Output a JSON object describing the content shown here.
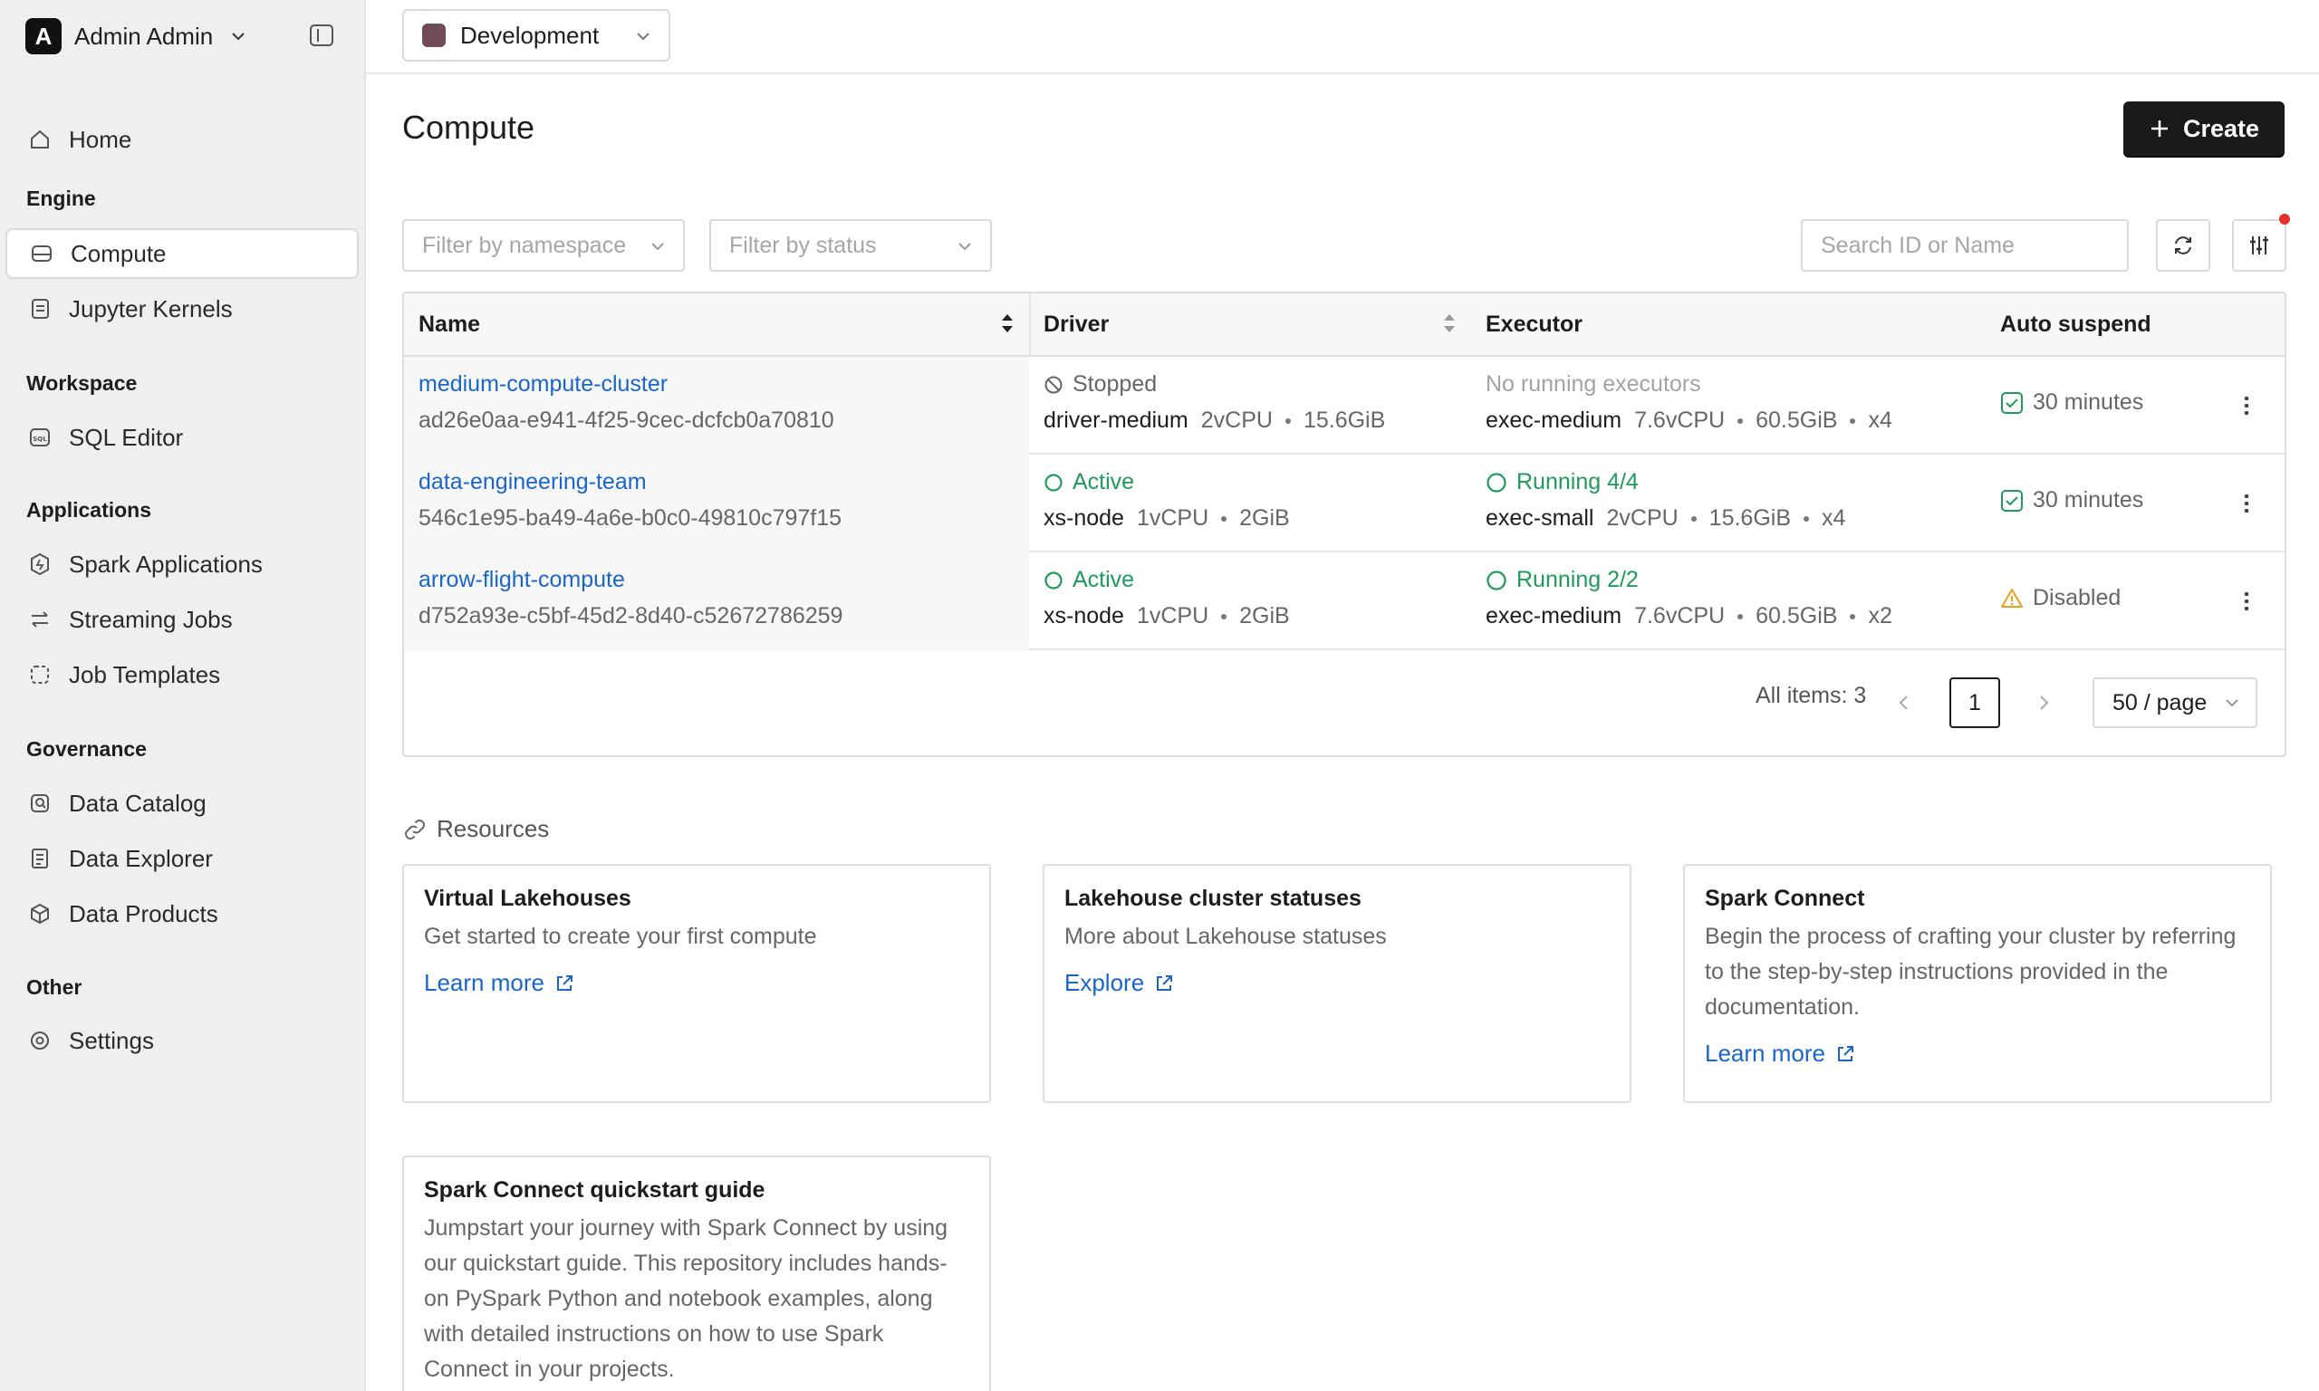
{
  "account": {
    "initial": "A",
    "name": "Admin Admin"
  },
  "nav": {
    "home": "Home",
    "sections": {
      "engine": "Engine",
      "workspace": "Workspace",
      "applications": "Applications",
      "governance": "Governance",
      "other": "Other"
    },
    "items": {
      "compute": "Compute",
      "jupyter": "Jupyter Kernels",
      "sql_editor": "SQL Editor",
      "spark_apps": "Spark Applications",
      "streaming": "Streaming Jobs",
      "job_templates": "Job Templates",
      "data_catalog": "Data Catalog",
      "data_explorer": "Data Explorer",
      "data_products": "Data Products",
      "settings": "Settings"
    }
  },
  "topbar": {
    "environment": "Development",
    "environment_color": "#6e4b56"
  },
  "page": {
    "title": "Compute",
    "create_label": "Create"
  },
  "filters": {
    "namespace_placeholder": "Filter by namespace",
    "status_placeholder": "Filter by status",
    "search_placeholder": "Search ID or Name"
  },
  "table": {
    "headers": {
      "name": "Name",
      "driver": "Driver",
      "executor": "Executor",
      "auto_suspend": "Auto suspend"
    },
    "rows": [
      {
        "name": "medium-compute-cluster",
        "id": "ad26e0aa-e941-4f25-9cec-dcfcb0a70810",
        "driver_status": "Stopped",
        "driver_node": "driver-medium",
        "driver_cpu": "2vCPU",
        "driver_mem": "15.6GiB",
        "executor_status": "No running executors",
        "executor_node": "exec-medium",
        "executor_cpu": "7.6vCPU",
        "executor_mem": "60.5GiB",
        "executor_count": "x4",
        "auto_suspend": "30 minutes"
      },
      {
        "name": "data-engineering-team",
        "id": "546c1e95-ba49-4a6e-b0c0-49810c797f15",
        "driver_status": "Active",
        "driver_node": "xs-node",
        "driver_cpu": "1vCPU",
        "driver_mem": "2GiB",
        "executor_status": "Running 4/4",
        "executor_node": "exec-small",
        "executor_cpu": "2vCPU",
        "executor_mem": "15.6GiB",
        "executor_count": "x4",
        "auto_suspend": "30 minutes"
      },
      {
        "name": "arrow-flight-compute",
        "id": "d752a93e-c5bf-45d2-8d40-c52672786259",
        "driver_status": "Active",
        "driver_node": "xs-node",
        "driver_cpu": "1vCPU",
        "driver_mem": "2GiB",
        "executor_status": "Running 2/2",
        "executor_node": "exec-medium",
        "executor_cpu": "7.6vCPU",
        "executor_mem": "60.5GiB",
        "executor_count": "x2",
        "auto_suspend": "Disabled"
      }
    ]
  },
  "pagination": {
    "total_label": "All items: 3",
    "current_page": "1",
    "page_size": "50 / page"
  },
  "resources": {
    "title": "Resources",
    "cards": [
      {
        "title": "Virtual Lakehouses",
        "desc": "Get started to create your first compute",
        "link": "Learn more"
      },
      {
        "title": "Lakehouse cluster statuses",
        "desc": "More about Lakehouse statuses",
        "link": "Explore"
      },
      {
        "title": "Spark Connect",
        "desc": "Begin the process of crafting your cluster by referring to the step-by-step instructions provided in the documentation.",
        "link": "Learn more"
      },
      {
        "title": "Spark Connect quickstart guide",
        "desc": "Jumpstart your journey with Spark Connect by using our quickstart guide. This repository includes hands-on PySpark Python and notebook examples, along with detailed instructions on how to use Spark Connect in your projects.",
        "link": ""
      }
    ]
  },
  "colors": {
    "link": "#1a66c9",
    "success": "#1f9a5b",
    "warning": "#e8a21a",
    "primary_button": "#1a1a1a"
  }
}
